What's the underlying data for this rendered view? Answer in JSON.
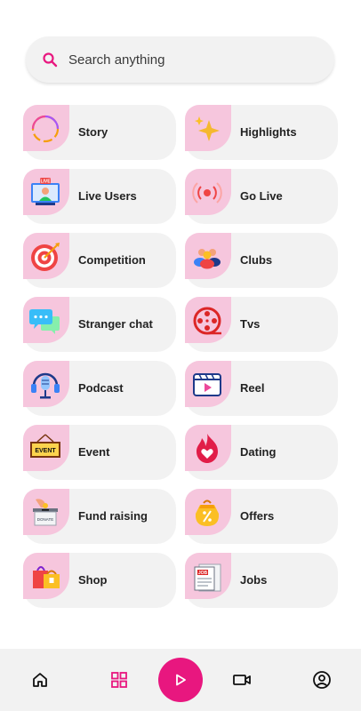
{
  "search": {
    "placeholder": "Search anything"
  },
  "colors": {
    "accent": "#e8177f",
    "badge": "#f6c6dd",
    "card": "#f2f2f2"
  },
  "menu": [
    {
      "label": "Story",
      "icon": "story-ring-icon"
    },
    {
      "label": "Highlights",
      "icon": "sparkle-icon"
    },
    {
      "label": "Live Users",
      "icon": "live-users-icon"
    },
    {
      "label": "Go Live",
      "icon": "broadcast-icon"
    },
    {
      "label": "Competition",
      "icon": "target-icon"
    },
    {
      "label": "Clubs",
      "icon": "group-icon"
    },
    {
      "label": "Stranger chat",
      "icon": "chat-bubbles-icon"
    },
    {
      "label": "Tvs",
      "icon": "film-reel-icon"
    },
    {
      "label": "Podcast",
      "icon": "podcast-mic-icon"
    },
    {
      "label": "Reel",
      "icon": "video-player-icon"
    },
    {
      "label": "Event",
      "icon": "event-sign-icon"
    },
    {
      "label": "Dating",
      "icon": "flame-heart-icon"
    },
    {
      "label": "Fund raising",
      "icon": "donation-box-icon"
    },
    {
      "label": "Offers",
      "icon": "offer-bag-icon"
    },
    {
      "label": "Shop",
      "icon": "shopping-bags-icon"
    },
    {
      "label": "Jobs",
      "icon": "job-newspaper-icon"
    }
  ],
  "sign_text": {
    "event": "EVENT",
    "donate": "DONATE",
    "job": "JOB",
    "live": "LIVE"
  },
  "bottom_nav": [
    "home-icon",
    "grid-icon",
    "play-icon",
    "video-camera-icon",
    "profile-icon"
  ]
}
